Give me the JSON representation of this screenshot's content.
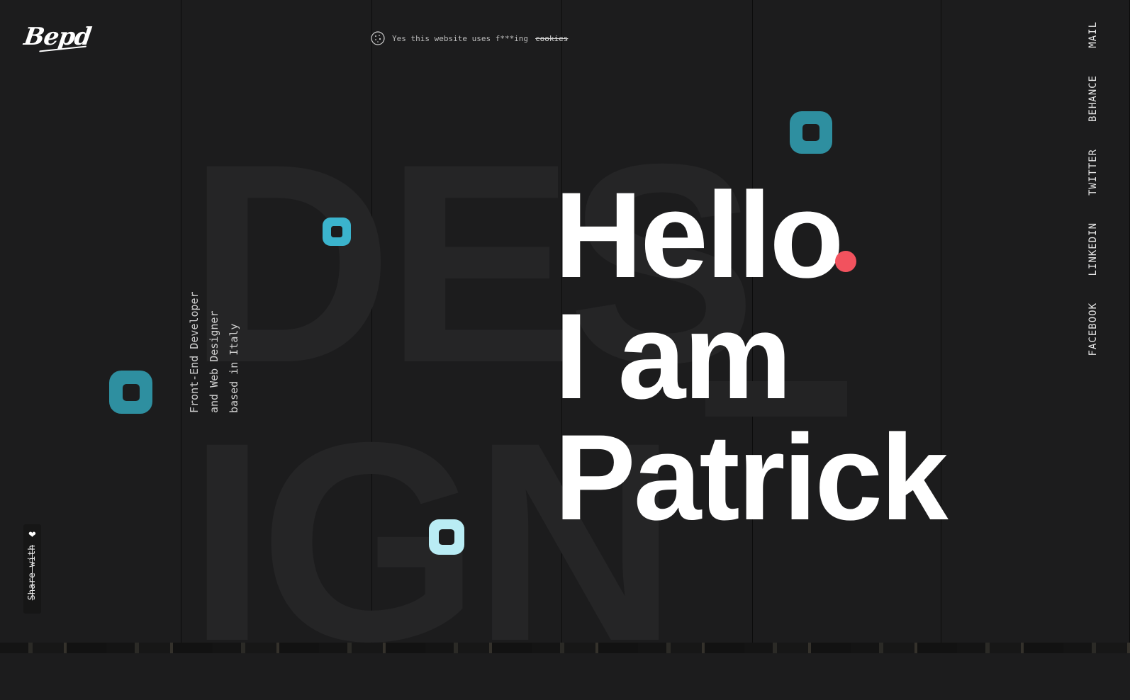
{
  "logo": {
    "text": "Bepd"
  },
  "cookie_notice": {
    "text": "Yes this website uses f***ing",
    "link_label": "cookies"
  },
  "background_text": {
    "line1": "DES",
    "line2": "IGN"
  },
  "hero": {
    "line1": "Hello",
    "line2": "I am",
    "line3": "Patrick"
  },
  "tagline": {
    "text": "Front-End Developer\nand Web Designer\nbased in Italy"
  },
  "social": {
    "items": [
      "MAIL",
      "BEHANCE",
      "TWITTER",
      "LINKEDIN",
      "FACEBOOK"
    ]
  },
  "share": {
    "label": "Share with"
  },
  "colors": {
    "background": "#1c1c1d",
    "accent_red": "#f2525e",
    "teal_dark": "#2e8fa0",
    "teal_mid": "#3bb4cd",
    "teal_light": "#b9ecf4"
  }
}
